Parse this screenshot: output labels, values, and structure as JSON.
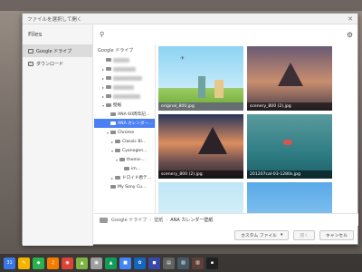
{
  "dialog": {
    "title": "ファイルを選択して開く",
    "close_glyph": "✕"
  },
  "sidebar": {
    "title": "Files",
    "items": [
      {
        "label": "Google ドライブ",
        "icon": "drive-folder-icon"
      },
      {
        "label": "ダウンロード",
        "icon": "download-folder-icon"
      }
    ]
  },
  "toolbar": {
    "search_glyph": "⚲",
    "settings_glyph": "⚙"
  },
  "tree": {
    "root_label": "Google ドライブ",
    "rows": [
      {
        "label": "",
        "indent": 1,
        "tri": "",
        "blurred": true
      },
      {
        "label": "",
        "indent": 1,
        "tri": "▸",
        "blurred": true
      },
      {
        "label": "",
        "indent": 1,
        "tri": "▸",
        "blurred": true
      },
      {
        "label": "",
        "indent": 1,
        "tri": "▸",
        "blurred": true
      },
      {
        "label": "",
        "indent": 1,
        "tri": "▸",
        "blurred": true
      },
      {
        "label": "壁紙",
        "indent": 1,
        "tri": "▾"
      },
      {
        "label": "ANA 60周年記…",
        "indent": 2,
        "tri": ""
      },
      {
        "label": "ANA カレンダー…",
        "indent": 2,
        "tri": "",
        "selected": true
      },
      {
        "label": "Chrome",
        "indent": 2,
        "tri": "▾"
      },
      {
        "label": "Classic Bl…",
        "indent": 3,
        "tri": "▸"
      },
      {
        "label": "Cyanogen…",
        "indent": 3,
        "tri": "▾"
      },
      {
        "label": "theme-…",
        "indent": 4,
        "tri": "▾"
      },
      {
        "label": "im…",
        "indent": 5,
        "tri": ""
      },
      {
        "label": "ドロイド君テ…",
        "indent": 3,
        "tri": "▸"
      },
      {
        "label": "My Sony Cu…",
        "indent": 2,
        "tri": ""
      }
    ]
  },
  "files": [
    {
      "name": "original_800.jpg"
    },
    {
      "name": "scenery_800 (2).jpg"
    },
    {
      "name": "scenery_800 (2).jpg"
    },
    {
      "name": "201207cal-03-1280s.jpg"
    },
    {
      "name": ""
    },
    {
      "name": ""
    }
  ],
  "breadcrumb": {
    "parts": [
      "Google ドライブ",
      "壁紙"
    ],
    "current": "ANA カレンダー壁紙"
  },
  "footer": {
    "type_select": "カスタム ファイル",
    "open_button": "開く",
    "cancel_button": "キャンセル"
  },
  "shelf": {
    "apps": [
      {
        "name": "calendar-app",
        "color": "#3b78e7",
        "glyph": "31"
      },
      {
        "name": "notes-app",
        "color": "#f4b400",
        "glyph": "✎"
      },
      {
        "name": "feedly-app",
        "color": "#2bb24c",
        "glyph": "◆"
      },
      {
        "name": "music-app",
        "color": "#f57c00",
        "glyph": "♫"
      },
      {
        "name": "chrome-app",
        "color": "#db4437",
        "glyph": "◉"
      },
      {
        "name": "android-app",
        "color": "#7cb342",
        "glyph": "▲"
      },
      {
        "name": "app-7",
        "color": "#9e9e9e",
        "glyph": "▣"
      },
      {
        "name": "drive-app",
        "color": "#0f9d58",
        "glyph": "▲"
      },
      {
        "name": "folder-app",
        "color": "#4285f4",
        "glyph": "■"
      },
      {
        "name": "pixel-app",
        "color": "#1565c0",
        "glyph": "✿"
      },
      {
        "name": "app-11",
        "color": "#3949ab",
        "glyph": "◼"
      },
      {
        "name": "store-app",
        "color": "#616161",
        "glyph": "▤"
      },
      {
        "name": "app-13",
        "color": "#455a64",
        "glyph": "▧"
      },
      {
        "name": "app-14",
        "color": "#5d4037",
        "glyph": "▥"
      },
      {
        "name": "app-15",
        "color": "#212121",
        "glyph": "▪"
      }
    ]
  }
}
